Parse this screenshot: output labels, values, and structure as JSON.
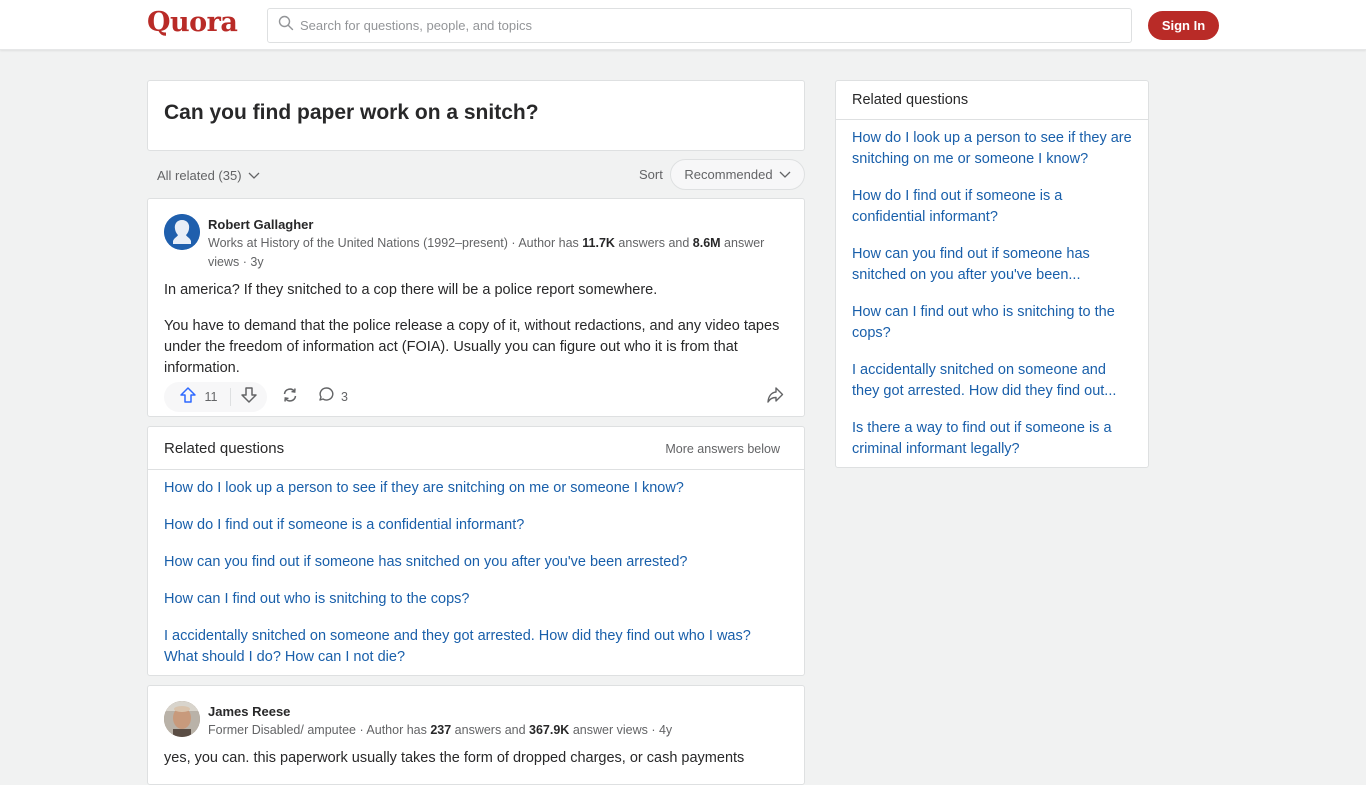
{
  "header": {
    "logo": "Quora",
    "search_placeholder": "Search for questions, people, and topics",
    "signin_label": "Sign In",
    "brand_color": "#b92b27"
  },
  "question": {
    "title": "Can you find paper work on a snitch?"
  },
  "filters": {
    "all_related_label": "All related (35)",
    "sort_label": "Sort",
    "sort_value": "Recommended"
  },
  "answers": [
    {
      "author": "Robert Gallagher",
      "credential": "Works at History of the United Nations (1992–present)",
      "meta_prefix": " · Author has ",
      "answers_count": "11.7K",
      "meta_mid": " answers and ",
      "views_count": "8.6M",
      "meta_suffix": " answer views · 3y",
      "paragraphs": [
        "In america? If they snitched to a cop there will be a police report somewhere.",
        "You have to demand that the police release a copy of it, without redactions, and any video tapes under the freedom of information act (FOIA). Usually you can figure out who it is from that information."
      ],
      "upvotes": "11",
      "comments": "3"
    },
    {
      "author": "James Reese",
      "credential": "Former Disabled/ amputee",
      "meta_prefix": " · Author has ",
      "answers_count": "237",
      "meta_mid": " answers and ",
      "views_count": "367.9K",
      "meta_suffix": " answer views · 4y",
      "paragraphs": [
        "yes, you can. this paperwork usually takes the form of dropped charges, or cash payments"
      ]
    }
  ],
  "inline_related": {
    "title": "Related questions",
    "more_label": "More answers below",
    "items": [
      "How do I look up a person to see if they are snitching on me or someone I know?",
      "How do I find out if someone is a confidential informant?",
      "How can you find out if someone has snitched on you after you've been arrested?",
      "How can I find out who is snitching to the cops?",
      "I accidentally snitched on someone and they got arrested. How did they find out who I was? What should I do? How can I not die?"
    ]
  },
  "sidebar": {
    "title": "Related questions",
    "items": [
      "How do I look up a person to see if they are snitching on me or someone I know?",
      "How do I find out if someone is a confidential informant?",
      "How can you find out if someone has snitched on you after you've been...",
      "How can I find out who is snitching to the cops?",
      "I accidentally snitched on someone and they got arrested. How did they find out...",
      "Is there a way to find out if someone is a criminal informant legally?"
    ]
  }
}
